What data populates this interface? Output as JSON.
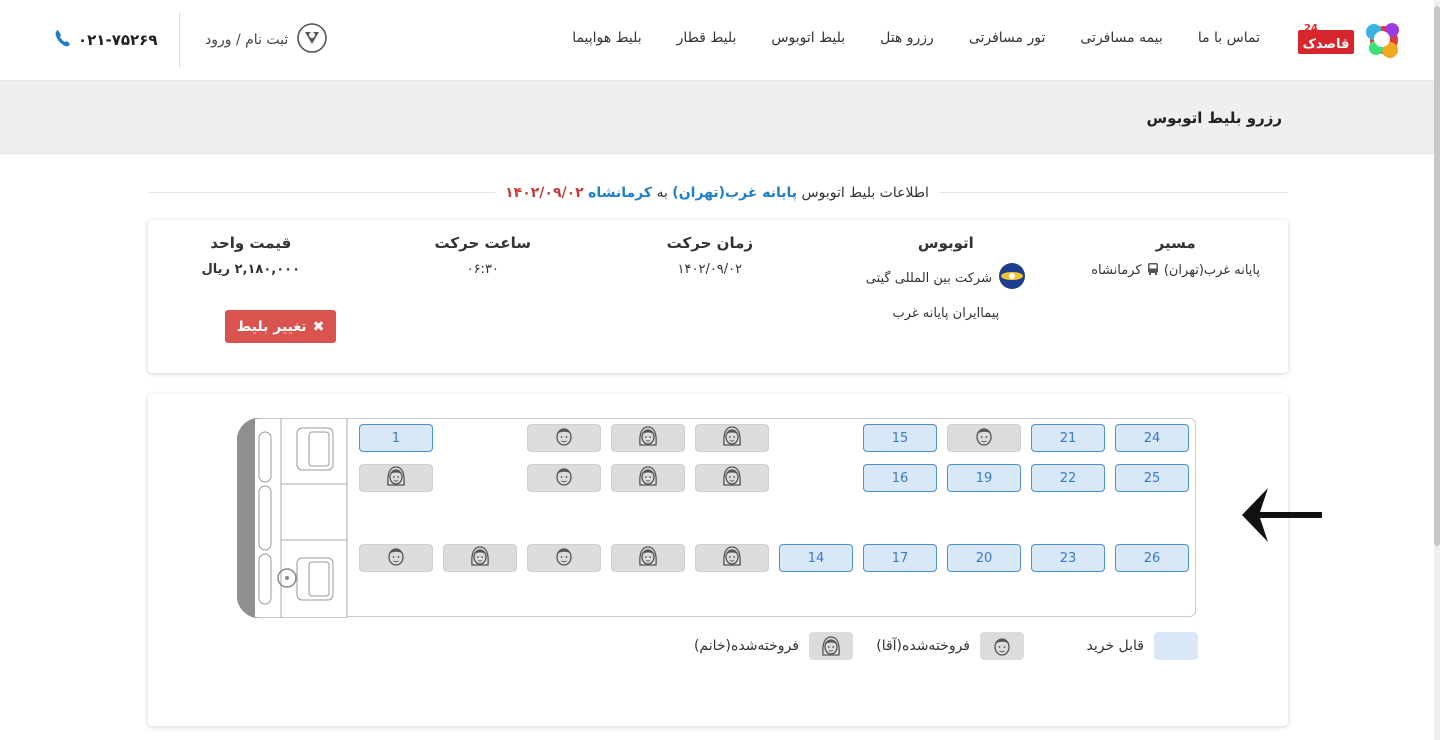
{
  "nav": {
    "items": [
      "بلیط هواپیما",
      "بلیط قطار",
      "بلیط اتوبوس",
      "رزرو هتل",
      "تور مسافرتی",
      "بیمه مسافرتی",
      "تماس با ما"
    ],
    "login_label": "ثبت نام / ورود",
    "phone": "۰۲۱-۷۵۲۶۹",
    "logo_text": "قاصدک",
    "logo_badge": "24"
  },
  "page": {
    "title": "رزرو بلیط اتوبوس"
  },
  "info": {
    "prefix": "اطلاعات بلیط اتوبوس",
    "origin": "پایانه غرب(تهران)",
    "to": "به",
    "destination": "کرمانشاه",
    "date": "۱۴۰۲/۰۹/۰۲"
  },
  "ticket": {
    "route_h": "مسیر",
    "route_v": "پایانه غرب(تهران)",
    "route_dest": "کرمانشاه",
    "bus_h": "اتوبوس",
    "company": "شرکت بین المللی گیتی",
    "terminal": "پیماایران پایانه غرب",
    "date_h": "زمان حرکت",
    "date_v": "۱۴۰۲/۰۹/۰۲",
    "time_h": "ساعت حرکت",
    "time_v": "۰۶:۳۰",
    "price_h": "قیمت واحد",
    "price_v": "۲,۱۸۰,۰۰۰ ریال",
    "change_btn": "تغییر بلیط"
  },
  "seats": {
    "row1": [
      {
        "label": "24",
        "status": "free"
      },
      {
        "label": "21",
        "status": "free"
      },
      {
        "label": "",
        "status": "sold-male"
      },
      {
        "label": "15",
        "status": "free"
      },
      {
        "label": "",
        "status": "empty"
      },
      {
        "label": "",
        "status": "sold-female"
      },
      {
        "label": "",
        "status": "sold-female"
      },
      {
        "label": "",
        "status": "sold-male"
      },
      {
        "label": "1",
        "status": "free"
      }
    ],
    "row2": [
      {
        "label": "25",
        "status": "free"
      },
      {
        "label": "22",
        "status": "free"
      },
      {
        "label": "19",
        "status": "free"
      },
      {
        "label": "16",
        "status": "free"
      },
      {
        "label": "",
        "status": "empty"
      },
      {
        "label": "",
        "status": "sold-female"
      },
      {
        "label": "",
        "status": "sold-female"
      },
      {
        "label": "",
        "status": "sold-male"
      },
      {
        "label": "",
        "status": "sold-female"
      }
    ],
    "row3": [
      {
        "label": "26",
        "status": "free"
      },
      {
        "label": "23",
        "status": "free"
      },
      {
        "label": "20",
        "status": "free"
      },
      {
        "label": "17",
        "status": "free"
      },
      {
        "label": "14",
        "status": "free"
      },
      {
        "label": "",
        "status": "sold-female"
      },
      {
        "label": "",
        "status": "sold-female"
      },
      {
        "label": "",
        "status": "sold-male"
      },
      {
        "label": "",
        "status": "sold-female"
      },
      {
        "label": "",
        "status": "sold-male"
      }
    ]
  },
  "legend": {
    "free": "قابل خرید",
    "male": "فروخته‌شده(آقا)",
    "female": "فروخته‌شده(خانم)"
  },
  "colors": {
    "accent": "#1e7fc9",
    "danger": "#d9534f",
    "seat_free_bg": "#d9e8f6",
    "seat_sold_bg": "#dcdcdc"
  }
}
